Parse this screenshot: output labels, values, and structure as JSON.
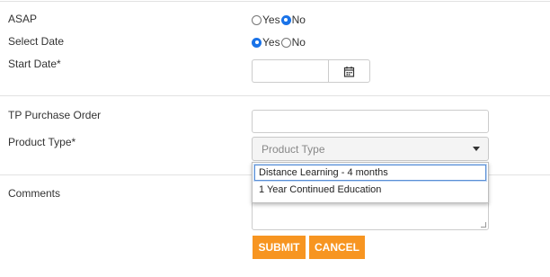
{
  "form": {
    "asap": {
      "label": "ASAP",
      "options": [
        "Yes",
        "No"
      ],
      "selected": "No"
    },
    "select_date": {
      "label": "Select Date",
      "options": [
        "Yes",
        "No"
      ],
      "selected": "Yes"
    },
    "start_date": {
      "label": "Start Date*",
      "value": "",
      "icon": "calendar-icon"
    },
    "tp_purchase_order": {
      "label": "TP Purchase Order",
      "value": ""
    },
    "product_type": {
      "label": "Product Type*",
      "placeholder": "Product Type",
      "options": [
        "Distance Learning - 4 months",
        "1 Year Continued Education"
      ],
      "highlighted": "Distance Learning - 4 months",
      "icon": "chevron-down-icon"
    },
    "comments": {
      "label": "Comments",
      "value": ""
    },
    "buttons": {
      "submit": "SUBMIT",
      "cancel": "CANCEL"
    }
  },
  "colors": {
    "accent": "#f79521",
    "radio_selected": "#1a73e8",
    "focus_outline": "#5a8fd6"
  }
}
